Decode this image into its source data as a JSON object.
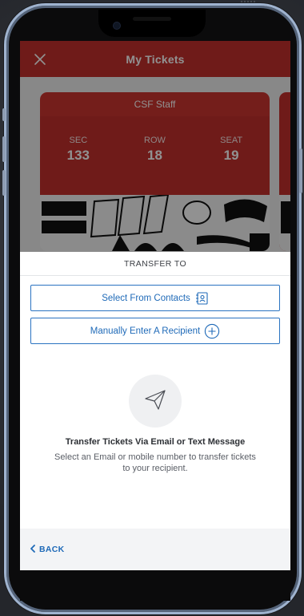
{
  "header": {
    "title": "My Tickets"
  },
  "ticket": {
    "section_name": "CSF Staff",
    "seat": {
      "sec_label": "SEC",
      "sec_value": "133",
      "row_label": "ROW",
      "row_value": "18",
      "seat_label": "SEAT",
      "seat_value": "19"
    }
  },
  "sheet": {
    "title": "TRANSFER TO",
    "select_contacts_label": "Select From Contacts",
    "manual_entry_label": "Manually Enter A Recipient",
    "info_title": "Transfer Tickets Via Email or Text Message",
    "info_subtitle": "Select an Email or mobile number to transfer tickets to your recipient.",
    "back_label": "BACK"
  },
  "icons": {
    "close": "close-icon",
    "contacts": "contact-book-icon",
    "add": "plus-circle-icon",
    "send": "paper-plane-icon",
    "back": "chevron-left-icon"
  },
  "colors": {
    "brand_red": "#c4312d",
    "link_blue": "#1f6ab8",
    "phone_frame": "#9fb3cf"
  }
}
